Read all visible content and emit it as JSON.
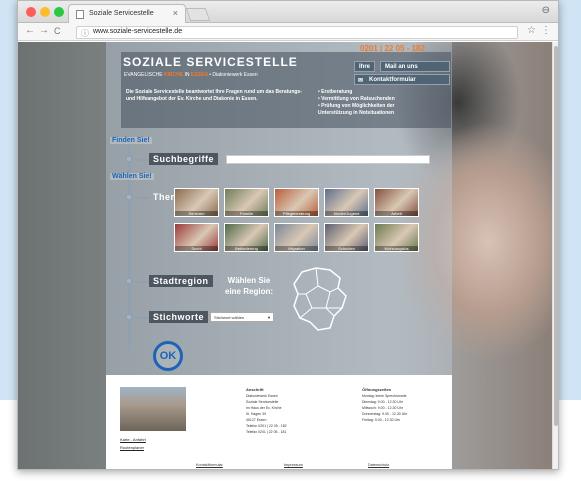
{
  "browser": {
    "tab_title": "Soziale Servicestelle",
    "tab_close": "×",
    "url": "www.soziale-servicestelle.de",
    "back": "←",
    "forward": "→",
    "reload": "C",
    "bookmark": "☆",
    "menu": "⋮",
    "window_control": "⊖"
  },
  "header": {
    "phone": "0201 | 22 05 - 182",
    "title": "SOZIALE SERVICESTELLE",
    "subtitle_pre": "EVANGELISCHE",
    "subtitle_kirche": "KIRCHE",
    "subtitle_in": "IN",
    "subtitle_essen": "ESSEN",
    "subtitle_post": "• Diakoniewerk Essen",
    "btn_ihre": "Ihre",
    "btn_mail": "Mail an uns",
    "btn_kontakt": "Kontaktformular",
    "intro": "Die Soziale Servicestelle beantwortet Ihre Fragen rund um das Beratungs- und Hilfeangebot der Ev. Kirche und Diakonie in Essen.",
    "bullets": [
      "• Erstberatung",
      "• Vermittlung von Ratsuchenden",
      "• Prüfung von Möglichkeiten der",
      "  Unterstützung in Notsituationen"
    ]
  },
  "finder": {
    "finden": "Finden Sie!",
    "suchbegriffe": "Suchbegriffe",
    "waehlen": "Wählen Sie!",
    "thema": "Thema",
    "stadtregion": "Stadtregion",
    "region_text_1": "Wählen Sie",
    "region_text_2": "eine Region:",
    "stichworte": "Stichworte",
    "select_value": "Stichwort wählen",
    "ok": "OK"
  },
  "themes": [
    {
      "label": "Senioren",
      "color": "#8a6c4f"
    },
    {
      "label": "Familie",
      "color": "#6f7d5b"
    },
    {
      "label": "Pflegeberatung",
      "color": "#b9603b"
    },
    {
      "label": "Kinder/Jugend",
      "color": "#5d6f8c"
    },
    {
      "label": "Arbeit",
      "color": "#84503e"
    },
    {
      "label": "Sucht",
      "color": "#9a3a3a"
    },
    {
      "label": "Behinderung",
      "color": "#4f6a4b"
    },
    {
      "label": "Migration",
      "color": "#7a8798"
    },
    {
      "label": "Schulden",
      "color": "#5c5f70"
    },
    {
      "label": "Wohnungslos",
      "color": "#6c7a4e"
    }
  ],
  "footer": {
    "link_karte": "Karte - Anfahrt",
    "link_routenplaner": "Routenplaner",
    "anschrift_title": "Anschrift",
    "anschrift_lines": [
      "Diakoniewerk Essen",
      "Soziale Servicestelle",
      "im Haus der Ev. Kirche",
      "III. Hagen 39",
      "45127 Essen",
      "Telefon 0201 | 22 05 - 182",
      "Telefax 0201 | 22 05 - 181"
    ],
    "oeffnung_title": "Öffnungszeiten",
    "oeffnung_lines": [
      "Montag: keine Sprechstunde",
      "Dienstag: 9.00 - 12.30 Uhr",
      "Mittwoch: 9.00 - 12.30 Uhr",
      "Donnerstag: 9.00 - 12.30 Uhr",
      "Freitag: 9.00 - 12.30 Uhr"
    ],
    "bottom_links": [
      "Kontaktformular",
      "Impressum",
      "Datenschutz"
    ]
  }
}
